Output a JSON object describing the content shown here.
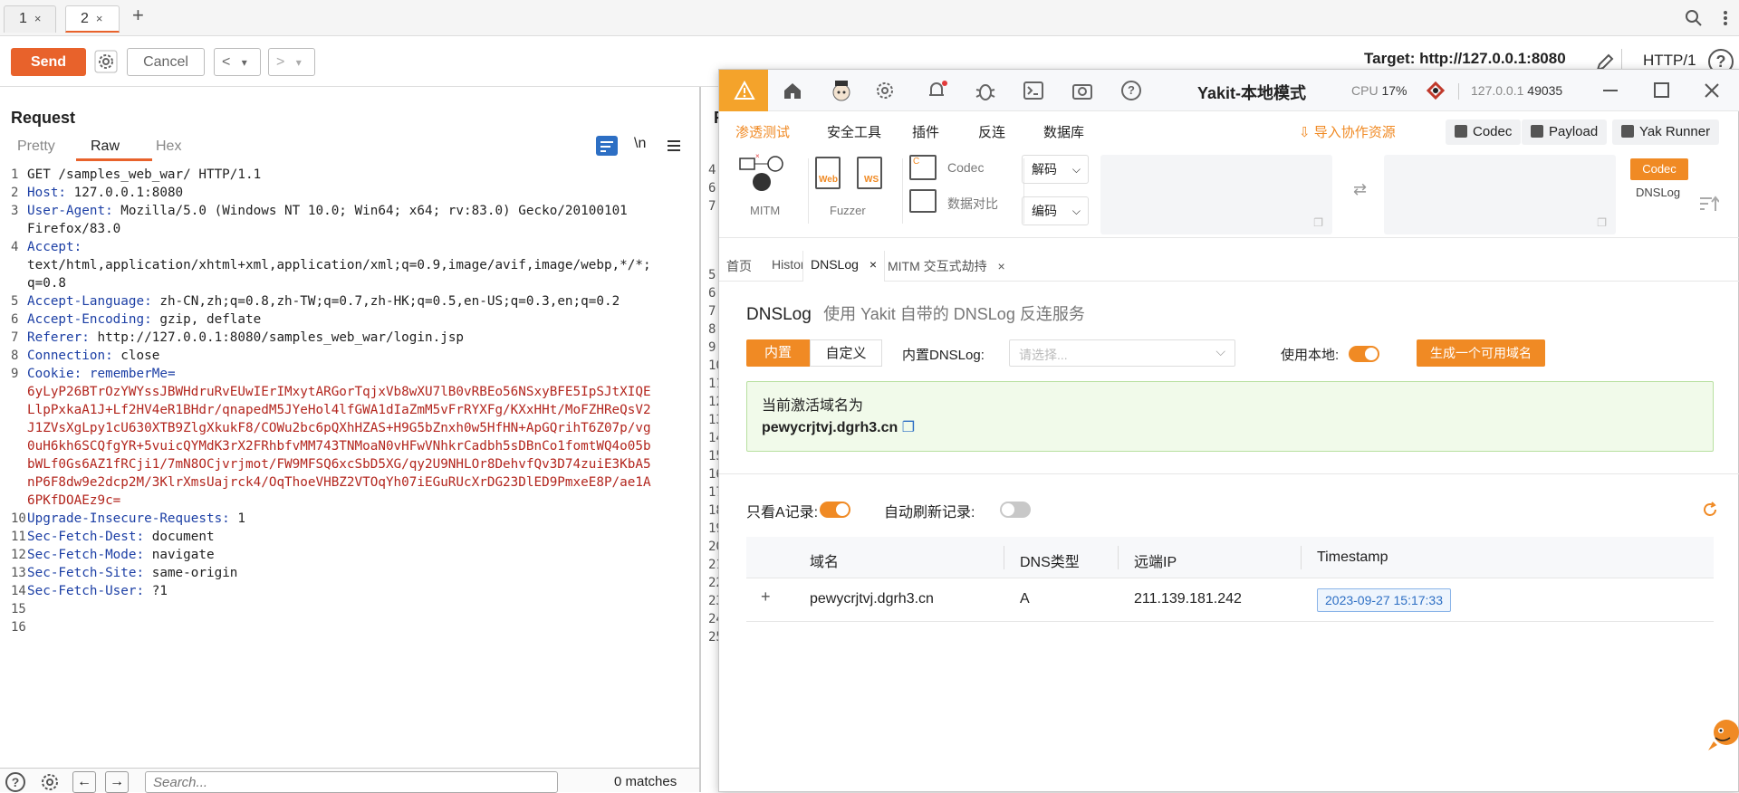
{
  "burp": {
    "tabs": [
      {
        "label": "1",
        "close": "×"
      },
      {
        "label": "2",
        "close": "×"
      }
    ],
    "add_tab": "+",
    "toolbar": {
      "send": "Send",
      "cancel": "Cancel",
      "prev": "<",
      "next": ">",
      "dropdown": "▾",
      "target": "Target: http://127.0.0.1:8080",
      "protocol": "HTTP/1",
      "help": "?"
    },
    "request": {
      "title": "Request",
      "tabs": [
        "Pretty",
        "Raw",
        "Hex"
      ],
      "newline_toggle": "\\n",
      "lines": [
        {
          "n": "1",
          "text": "GET /samples_web_war/ HTTP/1.1"
        },
        {
          "n": "2",
          "key": "Host:",
          "text": " 127.0.0.1:8080"
        },
        {
          "n": "3",
          "key": "User-Agent:",
          "text": " Mozilla/5.0 (Windows NT 10.0; Win64; x64; rv:83.0) Gecko/20100101"
        },
        {
          "n": "",
          "text": "Firefox/83.0"
        },
        {
          "n": "4",
          "key": "Accept:",
          "text": ""
        },
        {
          "n": "",
          "text": "text/html,application/xhtml+xml,application/xml;q=0.9,image/avif,image/webp,*/*;"
        },
        {
          "n": "",
          "text": "q=0.8"
        },
        {
          "n": "5",
          "key": "Accept-Language:",
          "text": " zh-CN,zh;q=0.8,zh-TW;q=0.7,zh-HK;q=0.5,en-US;q=0.3,en;q=0.2"
        },
        {
          "n": "6",
          "key": "Accept-Encoding:",
          "text": " gzip, deflate"
        },
        {
          "n": "7",
          "key": "Referer:",
          "text": " http://127.0.0.1:8080/samples_web_war/login.jsp"
        },
        {
          "n": "8",
          "key": "Connection:",
          "text": " close"
        },
        {
          "n": "9",
          "key": "Cookie:",
          "text": " rememberMe=",
          "red_key": true
        },
        {
          "n": "",
          "red": "6yLyP26BTrOzYWYssJBWHdruRvEUwIErIMxytARGorTqjxVb8wXU7lB0vRBEo56NSxyBFE5IpSJtXIQE"
        },
        {
          "n": "",
          "red": "LlpPxkaA1J+Lf2HV4eR1BHdr/qnapedM5JYeHol4lfGWA1dIaZmM5vFrRYXFg/KXxHHt/MoFZHReQsV2"
        },
        {
          "n": "",
          "red": "J1ZVsXgLpy1cU630XTB9ZlgXkukF8/COWu2bc6pQXhHZAS+H9G5bZnxh0w5HfHN+ApGQrihT6Z07p/vg"
        },
        {
          "n": "",
          "red": "0uH6kh6SCQfgYR+5vuicQYMdK3rX2FRhbfvMM743TNMoaN0vHFwVNhkrCadbh5sDBnCo1fomtWQ4o05b"
        },
        {
          "n": "",
          "red": "bWLf0Gs6AZ1fRCji1/7mN8OCjvrjmot/FW9MFSQ6xcSbD5XG/qy2U9NHLOr8DehvfQv3D74zuiE3KbA5"
        },
        {
          "n": "",
          "red": "nP6F8dw9e2dcp2M/3KlrXmsUajrck4/OqThoeVHBZ2VTOqYh07iEGuRUcXrDG23DlED9PmxeE8P/ae1A"
        },
        {
          "n": "",
          "red": "6PKfDOAEz9c="
        },
        {
          "n": "10",
          "key": "Upgrade-Insecure-Requests:",
          "text": " 1"
        },
        {
          "n": "11",
          "key": "Sec-Fetch-Dest:",
          "text": " document"
        },
        {
          "n": "12",
          "key": "Sec-Fetch-Mode:",
          "text": " navigate"
        },
        {
          "n": "13",
          "key": "Sec-Fetch-Site:",
          "text": " same-origin"
        },
        {
          "n": "14",
          "key": "Sec-Fetch-User:",
          "text": " ?1"
        },
        {
          "n": "15",
          "text": ""
        },
        {
          "n": "16",
          "text": ""
        }
      ]
    },
    "search": {
      "placeholder": "Search...",
      "matches": "0 matches"
    },
    "behind_line_numbers": [
      "5",
      "6",
      "7",
      "8",
      "9",
      "10",
      "11",
      "12",
      "13",
      "14",
      "15",
      "16",
      "17",
      "18",
      "19",
      "20",
      "21",
      "22",
      "23",
      "24",
      "25"
    ],
    "behind_title": "R",
    "behind_digits": [
      "4",
      "6",
      "7"
    ]
  },
  "yakit": {
    "title": "Yakit-本地模式",
    "cpu_label": "CPU",
    "cpu_value": "17%",
    "engine": "127.0.0.1",
    "port": "49035",
    "nav": [
      "渗透测试",
      "安全工具",
      "插件",
      "反连",
      "数据库"
    ],
    "import_label": "导入协作资源",
    "right_buttons": [
      "Codec",
      "Payload",
      "Yak Runner"
    ],
    "tools": {
      "mitm": "MITM",
      "fuzzer": "Fuzzer",
      "web_badge": "Web",
      "ws_badge": "WS",
      "codec": "Codec",
      "compare": "数据对比",
      "decode": "解码",
      "encode": "编码",
      "side_codec": "Codec",
      "side_dnslog": "DNSLog"
    },
    "tabs": [
      {
        "label": "首页",
        "close": ""
      },
      {
        "label": "History",
        "close": ""
      },
      {
        "label": "DNSLog",
        "close": "×"
      },
      {
        "label": "MITM 交互式劫持",
        "close": "×"
      }
    ],
    "dnslog": {
      "title": "DNSLog",
      "subtitle": "使用 Yakit 自带的 DNSLog 反连服务",
      "mode_builtin": "内置",
      "mode_custom": "自定义",
      "builtin_label": "内置DNSLog:",
      "select_placeholder": "请选择...",
      "use_local": "使用本地:",
      "generate": "生成一个可用域名",
      "active_label": "当前激活域名为",
      "active_domain": "pewycrjtvj.dgrh3.cn",
      "only_a": "只看A记录:",
      "auto_refresh": "自动刷新记录:",
      "table": {
        "columns": [
          "域名",
          "DNS类型",
          "远端IP",
          "Timestamp"
        ],
        "rows": [
          {
            "expand": "+",
            "domain": "pewycrjtvj.dgrh3.cn",
            "type": "A",
            "ip": "211.139.181.242",
            "timestamp": "2023-09-27 15:17:33"
          }
        ]
      }
    },
    "colors": {
      "accent": "#f08a24",
      "burp_orange": "#e8622b",
      "success_bg": "#f1faea"
    }
  }
}
